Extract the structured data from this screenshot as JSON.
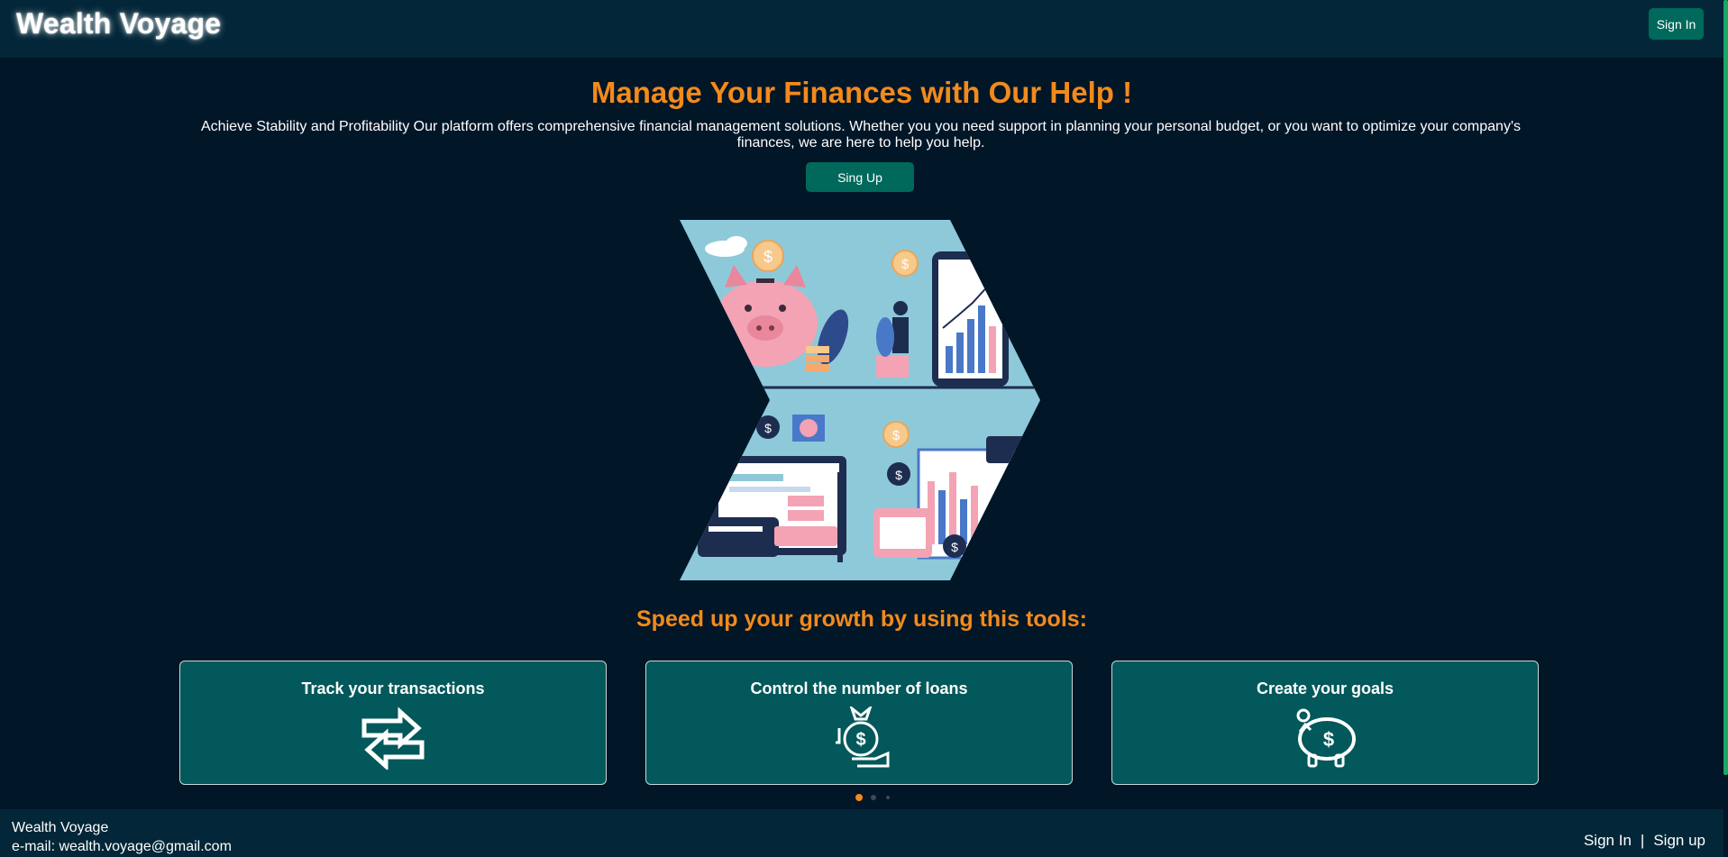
{
  "header": {
    "brand": "Wealth Voyage",
    "sign_in_label": "Sign In"
  },
  "hero": {
    "title": "Manage Your Finances with Our Help !",
    "description": "Achieve Stability and Profitability Our platform offers comprehensive financial management solutions. Whether you you need support in planning your personal budget, or you want to optimize your company's finances, we are here to help you help.",
    "signup_label": "Sing Up"
  },
  "tools": {
    "title": "Speed up your growth by using this tools:",
    "cards": [
      {
        "label": "Track your transactions",
        "icon": "transfer-arrows-icon"
      },
      {
        "label": "Control the number of loans",
        "icon": "money-bag-hand-icon"
      },
      {
        "label": "Create your goals",
        "icon": "piggy-bank-icon"
      }
    ]
  },
  "carousel": {
    "total": 3,
    "active_index": 1
  },
  "footer": {
    "brand": "Wealth Voyage",
    "email": "e-mail: wealth.voyage@gmail.com",
    "sign_in": "Sign In",
    "separator": "|",
    "sign_up": "Sign up"
  },
  "colors": {
    "background": "#011627",
    "header_bg": "#032738",
    "accent_orange": "#f28a1c",
    "button_green": "#00695c",
    "card_bg": "#02585a",
    "scrollbar": "#1aa865"
  }
}
